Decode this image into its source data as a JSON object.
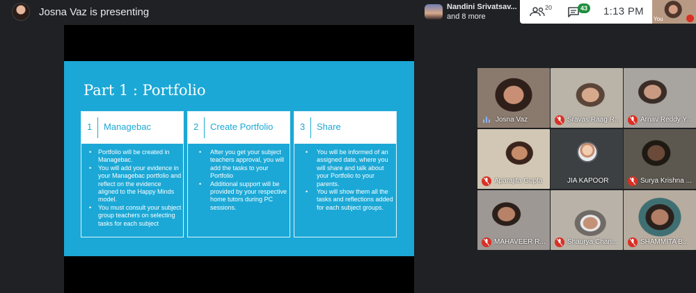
{
  "presenter": {
    "title": "Josna Vaz is presenting"
  },
  "viewers": {
    "name": "Nandini Srivatsav...",
    "more": "and 8 more"
  },
  "infobar": {
    "people_count": "20",
    "chat_count": "43",
    "time": "1:13 PM"
  },
  "self_view": {
    "label": "You"
  },
  "slide": {
    "title": "Part 1 : Portfolio",
    "columns": [
      {
        "number": "1",
        "name": "Managebac",
        "bullets": [
          "Portfolio will be created in Managebac.",
          "You will add your evidence in your Managebac portfolio and reflect on the evidence aligned to the Happy Minds model.",
          "You must consult your subject group teachers on selecting tasks for each subject"
        ]
      },
      {
        "number": "2",
        "name": "Create Portfolio",
        "bullets": [
          "After you get your subject teachers approval, you will add the tasks to your Portfolio",
          "Additional support will be provided by your respective home tutors during PC sessions."
        ]
      },
      {
        "number": "3",
        "name": "Share",
        "bullets": [
          "You will be informed of an assigned date, where you will  share and talk about your Portfolio to your parents.",
          "You will show them all the tasks and reflections added for each subject groups."
        ]
      }
    ]
  },
  "participants": [
    {
      "name": "Josna Vaz",
      "muted": false
    },
    {
      "name": "Sravas Raag R...",
      "muted": true
    },
    {
      "name": "Arnav Reddy Y...",
      "muted": true
    },
    {
      "name": "Aparajita Gupta",
      "muted": true
    },
    {
      "name": "JIA KAPOOR",
      "muted": false
    },
    {
      "name": "Surya Krishna ...",
      "muted": true
    },
    {
      "name": "MAHAVEER R...",
      "muted": true
    },
    {
      "name": "Shaurya Chan...",
      "muted": true
    },
    {
      "name": "SHAMMITA B...",
      "muted": true
    }
  ],
  "colors": {
    "slide_bg": "#1ba8d6",
    "mute_red": "#d93025",
    "chat_badge": "#1e8e3e"
  }
}
